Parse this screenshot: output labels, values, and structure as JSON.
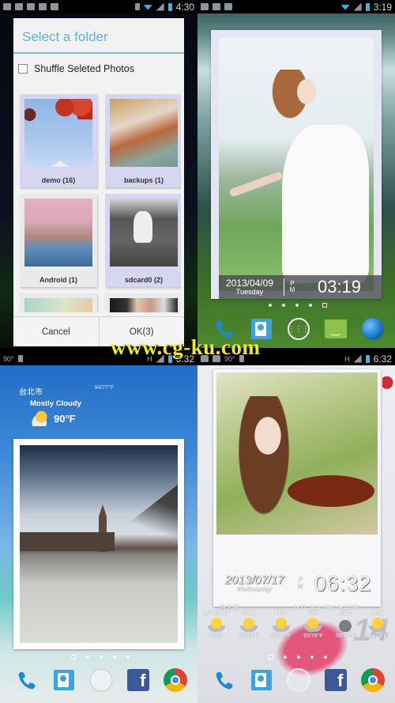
{
  "watermark": "www.cg-ku.com",
  "screens": {
    "folder_picker": {
      "status": {
        "time": "4:30"
      },
      "dialog": {
        "title": "Select a folder",
        "shuffle_label": "Shuffle Seleted Photos",
        "shuffle_checked": false,
        "folders": [
          {
            "name": "demo (16)",
            "selected": true
          },
          {
            "name": "backups (1)",
            "selected": true
          },
          {
            "name": "Android (1)",
            "selected": false
          },
          {
            "name": "sdcard0 (2)",
            "selected": true
          },
          {
            "name": "",
            "selected": false
          },
          {
            "name": "",
            "selected": false
          }
        ],
        "cancel_label": "Cancel",
        "ok_label": "OK(3)"
      }
    },
    "home_clock": {
      "status": {
        "time": "3:19"
      },
      "clock": {
        "date": "2013/04/09",
        "weekday": "Tuesday",
        "ampm_top": "P",
        "ampm_bottom": "M",
        "time": "03:19"
      },
      "dock": [
        "phone-icon",
        "contacts-icon",
        "app-drawer-icon",
        "messaging-icon",
        "browser-icon"
      ],
      "pages": 5,
      "active_page": 5
    },
    "home_weather": {
      "status": {
        "time": "6:32",
        "temp": "90°"
      },
      "weather": {
        "city": "台北市",
        "hi_lo": "94/77°F",
        "condition": "Mostly Cloudy",
        "temperature": "90°F"
      },
      "dock": [
        "phone-icon",
        "contacts-icon",
        "app-drawer-icon",
        "facebook-icon",
        "chrome-icon"
      ],
      "pages": 5,
      "active_page": 1
    },
    "home_violin": {
      "status": {
        "time": "6:32",
        "temp": "90°"
      },
      "clock": {
        "date": "2013/07/17",
        "weekday": "Wednesday",
        "ampm_top": "P",
        "ampm_bottom": "M",
        "time": "06:32"
      },
      "weather": {
        "city": "台北市",
        "condition": "Mostly Cl",
        "updated": "Jul 17, 2013 - Wed 06:32 PM",
        "forecast": [
          {
            "day": "",
            "temp": "90°F",
            "icon": "partly-cloudy"
          },
          {
            "day": "WED",
            "temp": "94/77°F",
            "icon": "sunny"
          },
          {
            "day": "THU",
            "temp": "93/78°F",
            "icon": "sunny"
          },
          {
            "day": "FRI",
            "temp": "92/79°F",
            "icon": "partly-cloudy"
          },
          {
            "day": "SAT",
            "temp": "92/77°F",
            "icon": "cloudy"
          },
          {
            "day": "SUN",
            "temp": "94/78°F",
            "icon": "partly-cloudy"
          }
        ]
      },
      "calendar_number": "14",
      "dock": [
        "phone-icon",
        "contacts-icon",
        "app-drawer-icon",
        "facebook-icon",
        "chrome-icon"
      ],
      "pages": 5,
      "active_page": 1
    }
  }
}
